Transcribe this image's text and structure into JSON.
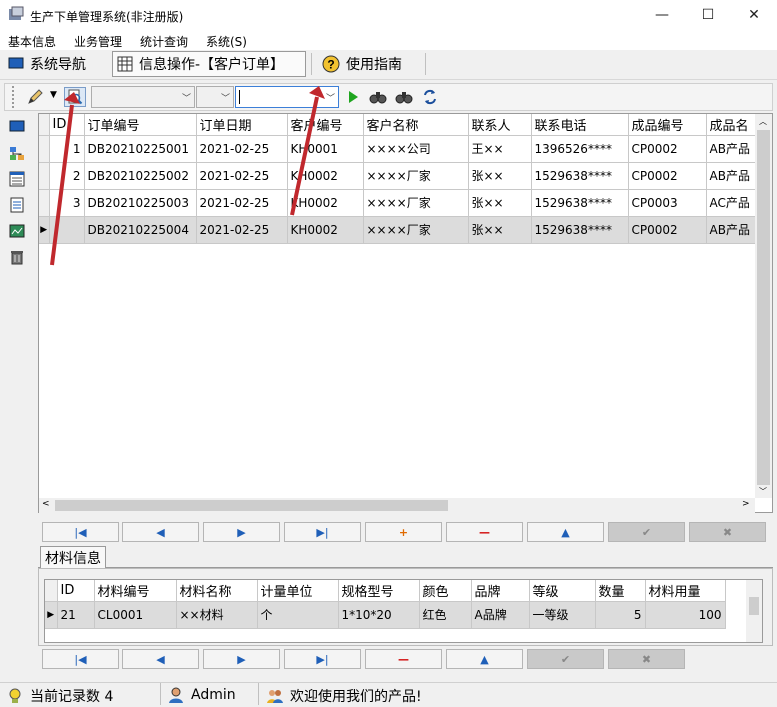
{
  "window": {
    "title": "生产下单管理系统(非注册版)",
    "minimize": "—",
    "maximize": "☐",
    "close": "✕"
  },
  "menu": [
    "基本信息",
    "业务管理",
    "统计查询",
    "系统(S)"
  ],
  "tabs": [
    {
      "label": "系统导航"
    },
    {
      "label": "信息操作-【客户订单】"
    },
    {
      "label": "使用指南"
    }
  ],
  "toolbar": {
    "search_value": ""
  },
  "orders": {
    "columns": [
      "ID",
      "订单编号",
      "订单日期",
      "客户编号",
      "客户名称",
      "联系人",
      "联系电话",
      "成品编号",
      "成品名"
    ],
    "rows": [
      [
        "1",
        "DB20210225001",
        "2021-02-25",
        "KH0001",
        "××××公司",
        "王××",
        "1396526****",
        "CP0002",
        "AB产品"
      ],
      [
        "2",
        "DB20210225002",
        "2021-02-25",
        "KH0002",
        "××××厂家",
        "张××",
        "1529638****",
        "CP0002",
        "AB产品"
      ],
      [
        "3",
        "DB20210225003",
        "2021-02-25",
        "KH0002",
        "××××厂家",
        "张××",
        "1529638****",
        "CP0003",
        "AC产品"
      ],
      [
        "",
        "DB20210225004",
        "2021-02-25",
        "KH0002",
        "××××厂家",
        "张××",
        "1529638****",
        "CP0002",
        "AB产品"
      ]
    ]
  },
  "materials": {
    "tab_label": "材料信息",
    "columns": [
      "ID",
      "材料编号",
      "材料名称",
      "计量单位",
      "规格型号",
      "颜色",
      "品牌",
      "等级",
      "数量",
      "材料用量"
    ],
    "rows": [
      [
        "21",
        "CL0001",
        "××材料",
        "个",
        "1*10*20",
        "红色",
        "A品牌",
        "一等级",
        "5",
        "100"
      ]
    ]
  },
  "status": {
    "records": "当前记录数 4",
    "user": "Admin",
    "welcome": "欢迎使用我们的产品!"
  },
  "colors": {
    "arrow": "#c0282d",
    "grid_line": "#c8c8c8",
    "selected_row": "#dcdcdc"
  }
}
